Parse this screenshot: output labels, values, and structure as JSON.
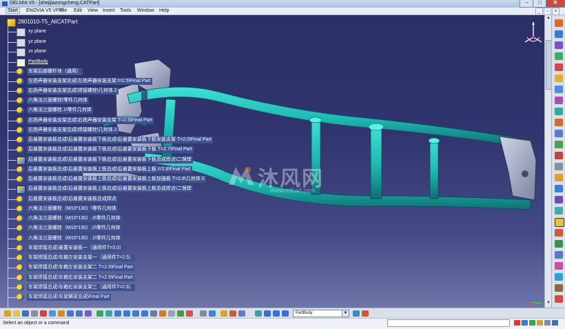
{
  "window": {
    "title": "DELMIA V5 - [shejijiazongcheng.CATPart]",
    "minimize_glyph": "–",
    "maximize_glyph": "□",
    "close_glyph": "✕"
  },
  "menu": {
    "items": [
      "Start",
      "ENOVIA V5 VPM",
      "File",
      "Edit",
      "View",
      "Insert",
      "Tools",
      "Window",
      "Help"
    ]
  },
  "tree": {
    "root": "2801010-T5_AllCATPart",
    "planes": [
      "xy plane",
      "yz plane",
      "zx plane"
    ],
    "part_body": "PartBody",
    "items": [
      "车架后部螺杆块（通用）",
      "左扬声器安装支架总成\\左扬声器安装支架 t=2.5\\Final Part",
      "右扬声器安装支架总成\\焊接螺栓\\几何体.2",
      "六角法兰面螺栓\\零件几何体",
      "六角法兰面螺栓.1\\零件几何体",
      "右扬声器安装支架总成\\右扬声器安装支架 T=2.5\\Final Part",
      "右扬声器安装支架总成\\焊接螺栓\\几何体.2",
      "后悬置安装板总成\\后悬置安装板下板总成\\后悬置安装板下板安装支架 T=2.0\\Final Part",
      "后悬置安装板总成\\后悬置安装板下板总成\\后悬置安装板下板 T=2.7\\Final Part",
      "后悬置安装板总成\\后悬置安装板下板总成\\后悬置安装板下板总成焊点\\二保焊",
      "后悬置安装板总成\\后悬置安装板上板总成\\后悬置安装板上板 t=2.8\\Final Part",
      "后悬置安装板总成\\后悬置安装板上板总成\\后悬置安装板上板加强板 T=2.8\\几何体.5",
      "后悬置安装板总成\\后悬置安装板上板总成\\后悬置安装板上板总成焊点\\二保焊",
      "后悬置安装板总成\\后悬置安装板总成焊点",
      "六角法兰面螺栓（M10*130）\\零件几何体",
      "六角法兰面螺栓（M10*130）.3\\零件几何体",
      "六角法兰面螺栓（M10*130）.2\\零件几何体",
      "六角法兰面螺栓（M10*130）.1\\零件几何体",
      "车架焊接总成\\悬置安装板一（通用件T=3.0）",
      "车架焊接总成\\车箱左安装支架一（通用件T=2.5）",
      "车架焊接总成\\车箱左安装支架二 T=2.5\\Final Part",
      "车架焊接总成\\车箱右安装支架二 T=2.5\\Final Part",
      "车架焊接总成\\车箱右安装支架三（通用件T=2.6）",
      "车架焊接总成\\车架横梁总成\\Final Part"
    ]
  },
  "watermark": {
    "brand": "沐风网",
    "url": "www.mfcad.com"
  },
  "toolbar": {
    "body_select": "PartBody"
  },
  "status": {
    "message": "Select an object or a command"
  },
  "colors": {
    "frame": "#1fb7b1",
    "frame_dark": "#0f6f74",
    "background": "#2c2f66",
    "tree_highlight": "#3e5291"
  }
}
